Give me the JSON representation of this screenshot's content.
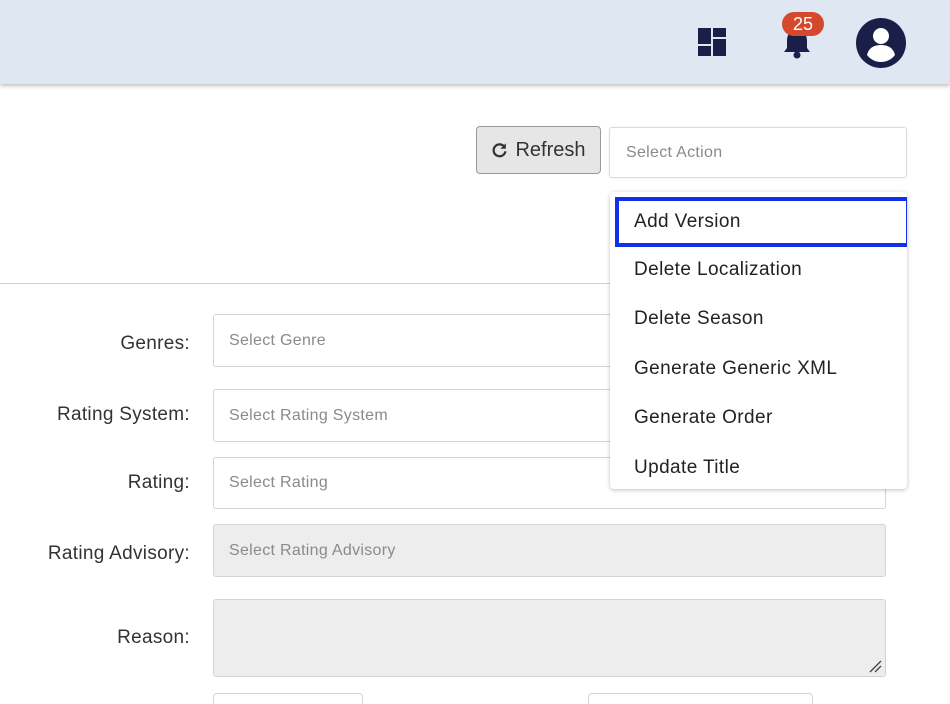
{
  "header": {
    "notification_count": "25",
    "icons": [
      "dashboard-icon",
      "bell-icon",
      "user-avatar-icon"
    ],
    "background_color": "#dfe7f2",
    "badge_color": "#d5482b",
    "icon_color": "#1a1f4a"
  },
  "toolbar": {
    "refresh_label": "Refresh",
    "action_placeholder": "Select Action"
  },
  "action_menu": {
    "items": [
      {
        "label": "Add Version"
      },
      {
        "label": "Delete Localization"
      },
      {
        "label": "Delete Season"
      },
      {
        "label": "Generate Generic XML"
      },
      {
        "label": "Generate Order"
      },
      {
        "label": "Update Title"
      }
    ],
    "highlighted_item": "Add Version",
    "highlight_color": "#1230e6"
  },
  "form": {
    "genres": {
      "label": "Genres:",
      "placeholder": "Select Genre"
    },
    "rating_system": {
      "label": "Rating System:",
      "placeholder": "Select Rating System"
    },
    "rating": {
      "label": "Rating:",
      "placeholder": "Select Rating"
    },
    "rating_advisory": {
      "label": "Rating Advisory:",
      "placeholder": "Select Rating Advisory"
    },
    "reason": {
      "label": "Reason:",
      "value": ""
    }
  }
}
